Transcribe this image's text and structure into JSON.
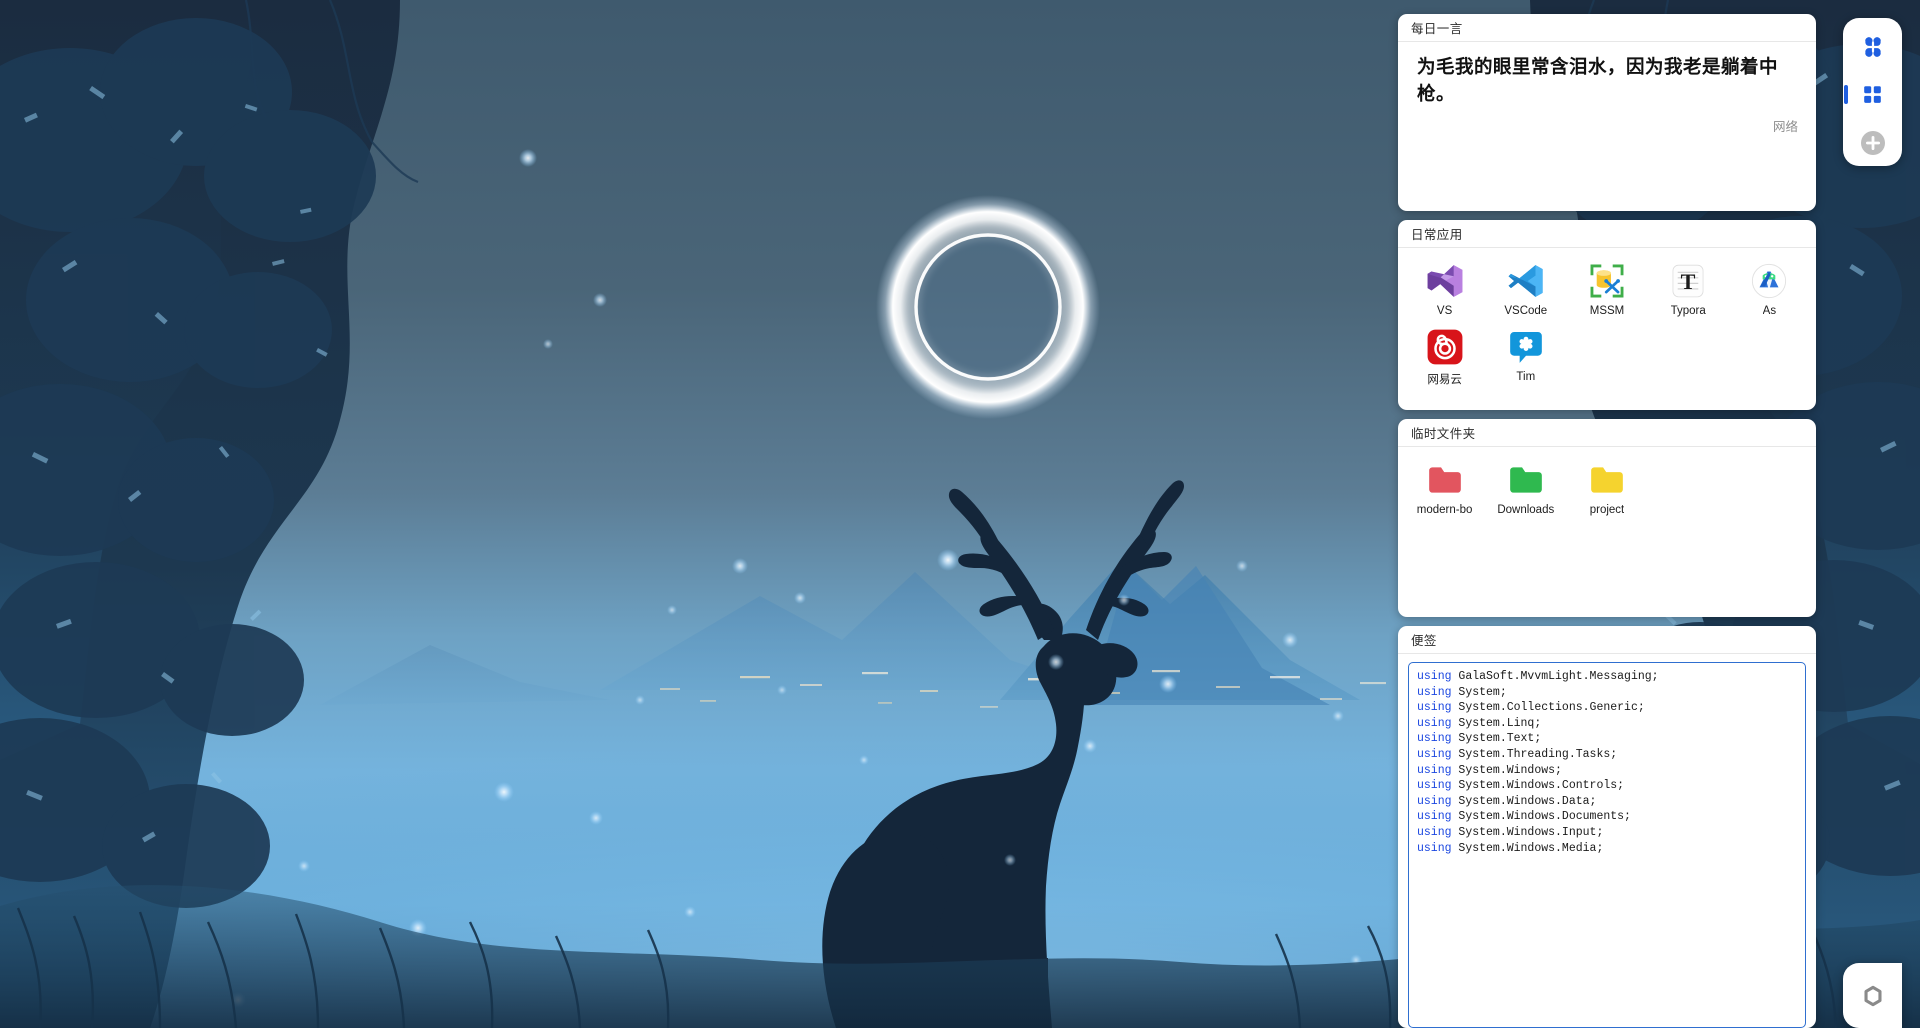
{
  "wallpaper": {
    "name": "night-forest-deer-eclipse",
    "sky_color": "#4a6478",
    "mist_color": "#5ba3d9",
    "forest_color": "#16283c",
    "accent_glow": "#cfe9ff"
  },
  "cards": {
    "quote": {
      "title": "每日一言",
      "text": "为毛我的眼里常含泪水，因为我老是躺着中枪。",
      "source": "网络"
    },
    "apps": {
      "title": "日常应用",
      "items": [
        {
          "label": "VS",
          "icon": "visual-studio-icon"
        },
        {
          "label": "VSCode",
          "icon": "vscode-icon"
        },
        {
          "label": "MSSM",
          "icon": "sql-server-management-studio-icon"
        },
        {
          "label": "Typora",
          "icon": "typora-icon"
        },
        {
          "label": "As",
          "icon": "android-studio-icon"
        },
        {
          "label": "网易云",
          "icon": "netease-music-icon"
        },
        {
          "label": "Tim",
          "icon": "tim-icon"
        }
      ]
    },
    "folders": {
      "title": "临时文件夹",
      "items": [
        {
          "label": "modern-bo",
          "icon": "folder-icon",
          "color": "#e2555f"
        },
        {
          "label": "Downloads",
          "icon": "folder-icon",
          "color": "#2fb94f"
        },
        {
          "label": "project",
          "icon": "folder-icon",
          "color": "#f5d32e"
        }
      ]
    },
    "notes": {
      "title": "便签",
      "code_lines": [
        {
          "keyword": "using",
          "rest": " GalaSoft.MvvmLight.Messaging;"
        },
        {
          "keyword": "using",
          "rest": " System;"
        },
        {
          "keyword": "using",
          "rest": " System.Collections.Generic;"
        },
        {
          "keyword": "using",
          "rest": " System.Linq;"
        },
        {
          "keyword": "using",
          "rest": " System.Text;"
        },
        {
          "keyword": "using",
          "rest": " System.Threading.Tasks;"
        },
        {
          "keyword": "using",
          "rest": " System.Windows;"
        },
        {
          "keyword": "using",
          "rest": " System.Windows.Controls;"
        },
        {
          "keyword": "using",
          "rest": " System.Windows.Data;"
        },
        {
          "keyword": "using",
          "rest": " System.Windows.Documents;"
        },
        {
          "keyword": "using",
          "rest": " System.Windows.Input;"
        },
        {
          "keyword": "using",
          "rest": " System.Windows.Media;"
        }
      ]
    }
  },
  "dock": {
    "buttons": [
      {
        "name": "clover-icon",
        "active": false
      },
      {
        "name": "grid-icon",
        "active": true
      },
      {
        "name": "add-icon",
        "active": false
      }
    ],
    "settings": {
      "name": "gear-icon"
    }
  },
  "theme": {
    "accent": "#1f5fe0",
    "card_bg": "#ffffff",
    "code_keyword": "#1b47e0",
    "muted_text": "#8d8d8d"
  }
}
